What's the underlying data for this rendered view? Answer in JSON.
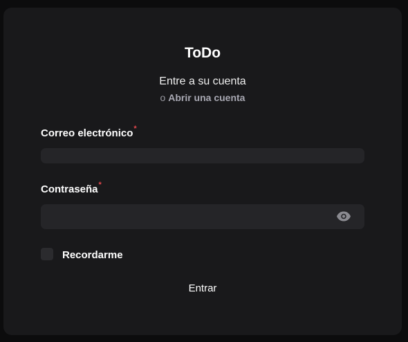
{
  "app": {
    "title": "ToDo"
  },
  "header": {
    "subtitle": "Entre a su cuenta",
    "alt_prefix": "o",
    "alt_link": "Abrir una cuenta"
  },
  "form": {
    "email": {
      "label": "Correo electrónico",
      "required_mark": "*",
      "value": ""
    },
    "password": {
      "label": "Contraseña",
      "required_mark": "*",
      "value": "",
      "toggle_icon": "eye-icon"
    },
    "remember": {
      "label": "Recordarme",
      "checked": false
    },
    "submit_label": "Entrar"
  },
  "colors": {
    "background": "#0c0c0d",
    "card": "#19191b",
    "input": "#252528",
    "required": "#e5484d",
    "muted": "#9a9aa2"
  }
}
